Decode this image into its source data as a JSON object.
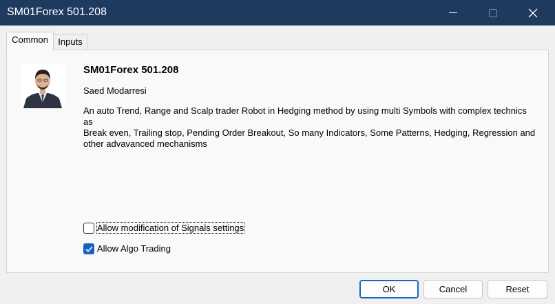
{
  "window": {
    "title": "SM01Forex 501.208",
    "controls": [
      "minimize-icon",
      "maximize-icon",
      "close-icon"
    ],
    "titlebar_color": "#1e3a5f"
  },
  "tabs": [
    {
      "label": "Common",
      "active": true
    },
    {
      "label": "Inputs",
      "active": false
    }
  ],
  "expert": {
    "name": "SM01Forex 501.208",
    "author": "Saed Modarresi",
    "description_lines": [
      "An auto Trend, Range and Scalp trader Robot in Hedging method by using multi Symbols with complex technics",
      "as",
      "Break even, Trailing stop, Pending Order Breakout, So many Indicators, Some Patterns, Hedging, Regression and",
      "other advavanced mechanisms"
    ]
  },
  "options": {
    "allow_signals": {
      "label": "Allow modification of Signals settings",
      "checked": false
    },
    "allow_algo": {
      "label": "Allow Algo Trading",
      "checked": true
    }
  },
  "buttons": {
    "ok": "OK",
    "cancel": "Cancel",
    "reset": "Reset"
  },
  "colors": {
    "accent": "#1565c0"
  }
}
